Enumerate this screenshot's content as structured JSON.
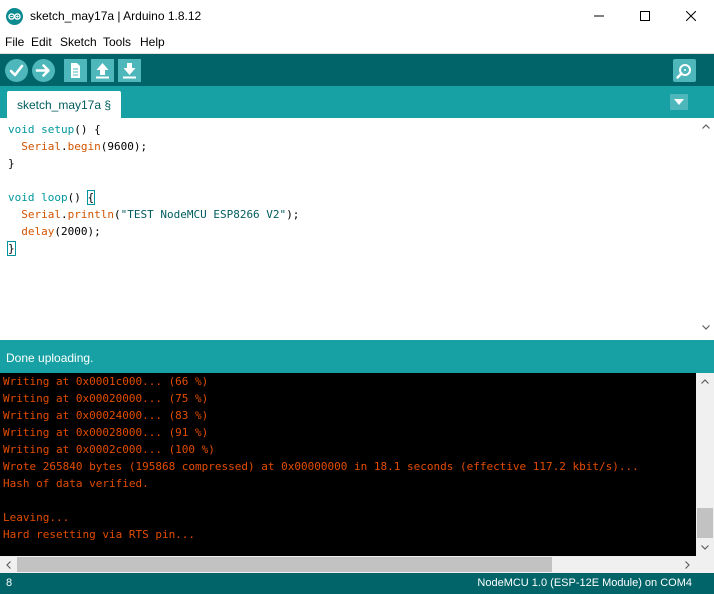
{
  "window": {
    "title": "sketch_may17a | Arduino 1.8.12"
  },
  "menubar": {
    "items": [
      "File",
      "Edit",
      "Sketch",
      "Tools",
      "Help"
    ]
  },
  "toolbar": {
    "buttons": [
      "verify-icon",
      "upload-icon",
      "new-icon",
      "open-icon",
      "save-icon"
    ],
    "serial_monitor_icon": "magnifier-icon"
  },
  "tabs": {
    "active_label": "sketch_may17a §"
  },
  "editor": {
    "code": {
      "line1_kw": "void",
      "line1_fn": "setup",
      "line1_rest": "() {",
      "line2_obj": "Serial",
      "line2_method": "begin",
      "line2_rest": "(9600);",
      "line3": "}",
      "line5_kw": "void",
      "line5_fn": "loop",
      "line5_rest": "() ",
      "line5_brace": "{",
      "line6_obj": "Serial",
      "line6_method": "println",
      "line6_open": "(",
      "line6_str": "\"TEST NodeMCU ESP8266 V2\"",
      "line6_close": ");",
      "line7_fn": "delay",
      "line7_rest": "(2000);",
      "line8": "}"
    }
  },
  "status": {
    "message": "Done uploading."
  },
  "console": {
    "lines": [
      "Writing at 0x0001c000... (66 %)",
      "Writing at 0x00020000... (75 %)",
      "Writing at 0x00024000... (83 %)",
      "Writing at 0x00028000... (91 %)",
      "Writing at 0x0002c000... (100 %)",
      "Wrote 265840 bytes (195868 compressed) at 0x00000000 in 18.1 seconds (effective 117.2 kbit/s)...",
      "Hash of data verified.",
      "",
      "Leaving...",
      "Hard resetting via RTS pin..."
    ]
  },
  "bottombar": {
    "line_number": "8",
    "board": "NodeMCU 1.0 (ESP-12E Module) on COM4"
  },
  "colors": {
    "teal_dark": "#006468",
    "teal_mid": "#17a1a5",
    "teal_light": "#4db7bb",
    "console_text": "#e34c00"
  }
}
